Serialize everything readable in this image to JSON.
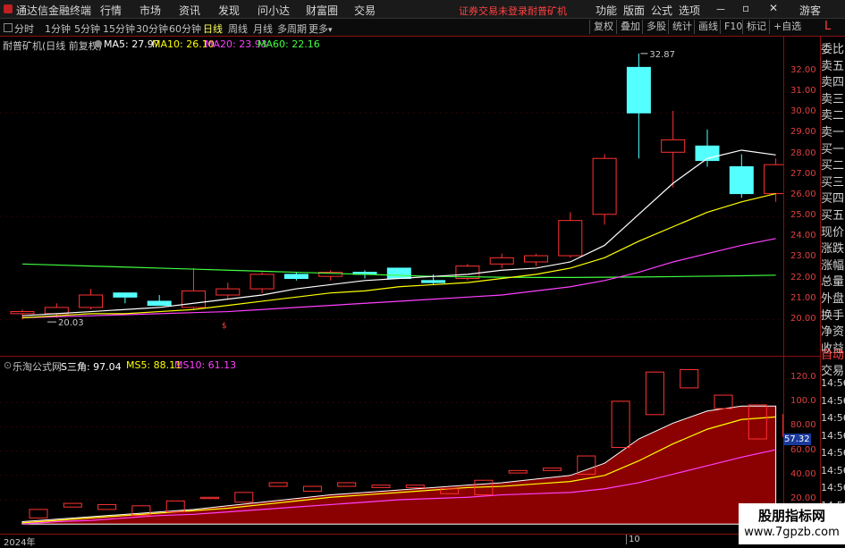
{
  "menubar": {
    "app_title": "通达信金融终端",
    "items": [
      "行情",
      "市场",
      "资讯",
      "发现",
      "问小达",
      "财富圈",
      "交易"
    ],
    "warning": "证券交易未登录",
    "stock_name": "耐普矿机",
    "right_items": [
      "功能",
      "版面",
      "公式",
      "选项"
    ],
    "guest": "游客"
  },
  "toolbar": {
    "periods": [
      "分时",
      "1分钟",
      "5分钟",
      "15分钟",
      "30分钟",
      "60分钟",
      "日线",
      "周线",
      "月线",
      "多周期",
      "更多"
    ],
    "active_period": "日线",
    "right_buttons": [
      "复权",
      "叠加",
      "多股",
      "统计",
      "画线",
      "F10",
      "标记",
      "+自选"
    ],
    "corner": "L"
  },
  "main_chart": {
    "title": "耐普矿机(日线 前复权)",
    "ma": [
      {
        "label": "MA5: 27.97",
        "color": "#ffffff"
      },
      {
        "label": "MA10: 26.10",
        "color": "#ffff00"
      },
      {
        "label": "MA20: 23.93",
        "color": "#ff40ff"
      },
      {
        "label": "MA60: 22.16",
        "color": "#40ff40"
      }
    ],
    "high_label": "32.87",
    "low_label": "20.03",
    "axis": [
      "32.00",
      "31.00",
      "30.00",
      "29.00",
      "28.00",
      "27.00",
      "26.00",
      "25.00",
      "24.00",
      "23.00",
      "22.00",
      "21.00",
      "20.00"
    ]
  },
  "sub_chart": {
    "title": "乐淘公式网",
    "values": [
      {
        "label": "S三角: 97.04",
        "color": "#ffffff"
      },
      {
        "label": "MS5: 88.11",
        "color": "#ffff00"
      },
      {
        "label": "MS10: 61.13",
        "color": "#ff40ff"
      }
    ],
    "axis": [
      "120.0",
      "100.0",
      "80.00",
      "60.00",
      "40.00",
      "20.00"
    ],
    "current_value": "57.32"
  },
  "side_list": {
    "upper": [
      "委比",
      "卖五",
      "卖四",
      "卖三",
      "卖二",
      "卖一",
      "买一",
      "买二",
      "买三",
      "买四",
      "买五",
      "现价",
      "涨跌",
      "涨幅",
      "总量",
      "外盘",
      "换手",
      "净资",
      "收益"
    ],
    "auto": "自动",
    "trade": "交易",
    "times": [
      "14:56",
      "14:56",
      "14:56",
      "14:56",
      "14:56",
      "14:56",
      "14:56",
      "14:56",
      "14:56"
    ]
  },
  "date_labels": {
    "year": "2024年",
    "month": "10"
  },
  "watermark": {
    "line1": "股朋指标网",
    "line2": "www.7gpzb.com"
  },
  "chart_data": {
    "type": "candlestick",
    "candles": [
      {
        "o": 20.3,
        "h": 20.5,
        "l": 20.03,
        "c": 20.4
      },
      {
        "o": 20.3,
        "h": 20.8,
        "l": 20.1,
        "c": 20.6
      },
      {
        "o": 20.6,
        "h": 21.5,
        "l": 20.5,
        "c": 21.2
      },
      {
        "o": 21.3,
        "h": 21.3,
        "l": 20.8,
        "c": 21.1
      },
      {
        "o": 20.9,
        "h": 21.2,
        "l": 20.7,
        "c": 20.7
      },
      {
        "o": 20.6,
        "h": 22.5,
        "l": 20.5,
        "c": 21.4
      },
      {
        "o": 21.2,
        "h": 21.8,
        "l": 21.0,
        "c": 21.5
      },
      {
        "o": 21.5,
        "h": 22.3,
        "l": 21.3,
        "c": 22.2
      },
      {
        "o": 22.2,
        "h": 22.3,
        "l": 21.9,
        "c": 22.0
      },
      {
        "o": 22.1,
        "h": 22.4,
        "l": 21.9,
        "c": 22.3
      },
      {
        "o": 22.3,
        "h": 22.4,
        "l": 22.0,
        "c": 22.2
      },
      {
        "o": 22.5,
        "h": 22.5,
        "l": 22.0,
        "c": 22.0
      },
      {
        "o": 21.9,
        "h": 22.2,
        "l": 21.7,
        "c": 21.8
      },
      {
        "o": 22.0,
        "h": 22.7,
        "l": 21.9,
        "c": 22.6
      },
      {
        "o": 22.7,
        "h": 23.2,
        "l": 22.5,
        "c": 23.0
      },
      {
        "o": 22.8,
        "h": 23.2,
        "l": 22.6,
        "c": 23.1
      },
      {
        "o": 23.1,
        "h": 25.2,
        "l": 23.0,
        "c": 24.8
      },
      {
        "o": 25.1,
        "h": 28.0,
        "l": 24.6,
        "c": 27.8
      },
      {
        "o": 32.2,
        "h": 32.87,
        "l": 27.8,
        "c": 30.0
      },
      {
        "o": 28.1,
        "h": 30.1,
        "l": 26.4,
        "c": 28.7
      },
      {
        "o": 28.4,
        "h": 29.2,
        "l": 27.4,
        "c": 27.7
      },
      {
        "o": 27.4,
        "h": 28.0,
        "l": 25.9,
        "c": 26.1
      },
      {
        "o": 26.1,
        "h": 27.8,
        "l": 25.7,
        "c": 27.5
      }
    ],
    "ma5": [
      20.2,
      20.3,
      20.4,
      20.5,
      20.6,
      20.8,
      21.0,
      21.2,
      21.5,
      21.7,
      21.9,
      22.0,
      22.1,
      22.2,
      22.4,
      22.5,
      22.8,
      23.6,
      25.1,
      26.6,
      27.8,
      28.2,
      27.97
    ],
    "ma10": [
      20.1,
      20.2,
      20.3,
      20.3,
      20.4,
      20.5,
      20.7,
      20.9,
      21.1,
      21.3,
      21.4,
      21.6,
      21.7,
      21.8,
      22.0,
      22.2,
      22.5,
      23.0,
      23.8,
      24.5,
      25.2,
      25.7,
      26.1
    ],
    "ma20": [
      20.1,
      20.15,
      20.2,
      20.25,
      20.3,
      20.35,
      20.4,
      20.5,
      20.6,
      20.7,
      20.8,
      20.9,
      21.0,
      21.1,
      21.2,
      21.4,
      21.6,
      21.9,
      22.3,
      22.8,
      23.2,
      23.6,
      23.93
    ],
    "ma60": [
      22.7,
      22.65,
      22.6,
      22.55,
      22.5,
      22.45,
      22.4,
      22.35,
      22.3,
      22.25,
      22.2,
      22.15,
      22.1,
      22.08,
      22.06,
      22.05,
      22.05,
      22.06,
      22.07,
      22.09,
      22.11,
      22.13,
      22.16
    ],
    "sub": {
      "boxes": [
        {
          "o": 5,
          "c": 12
        },
        {
          "o": 14,
          "c": 17
        },
        {
          "o": 12,
          "c": 16
        },
        {
          "o": 7,
          "c": 15
        },
        {
          "o": 10,
          "c": 19
        },
        {
          "o": 21,
          "c": 22
        },
        {
          "o": 18,
          "c": 26
        },
        {
          "o": 31,
          "c": 34
        },
        {
          "o": 27,
          "c": 31
        },
        {
          "o": 31,
          "c": 34
        },
        {
          "o": 30,
          "c": 32
        },
        {
          "o": 30,
          "c": 32
        },
        {
          "o": 25,
          "c": 29
        },
        {
          "o": 24,
          "c": 36
        },
        {
          "o": 42,
          "c": 44
        },
        {
          "o": 44,
          "c": 46
        },
        {
          "o": 41,
          "c": 56
        },
        {
          "o": 63,
          "c": 101
        },
        {
          "o": 90,
          "c": 125
        },
        {
          "o": 112,
          "c": 127
        },
        {
          "o": 95,
          "c": 106
        },
        {
          "o": 70,
          "c": 98
        },
        {
          "o": 72,
          "c": 90
        }
      ],
      "area": [
        2,
        4,
        6,
        8,
        10,
        12,
        15,
        18,
        21,
        24,
        26,
        28,
        30,
        32,
        34,
        37,
        40,
        50,
        70,
        83,
        93,
        97,
        97.04
      ],
      "ms5": [
        1,
        3,
        5,
        7,
        9,
        11,
        13,
        16,
        19,
        22,
        24,
        26,
        28,
        30,
        31,
        33,
        35,
        40,
        52,
        66,
        78,
        86,
        88.11
      ],
      "ms10": [
        0,
        2,
        3,
        5,
        7,
        8,
        10,
        12,
        14,
        16,
        18,
        20,
        21,
        22,
        24,
        25,
        26,
        29,
        34,
        41,
        48,
        55,
        61.13
      ]
    }
  }
}
